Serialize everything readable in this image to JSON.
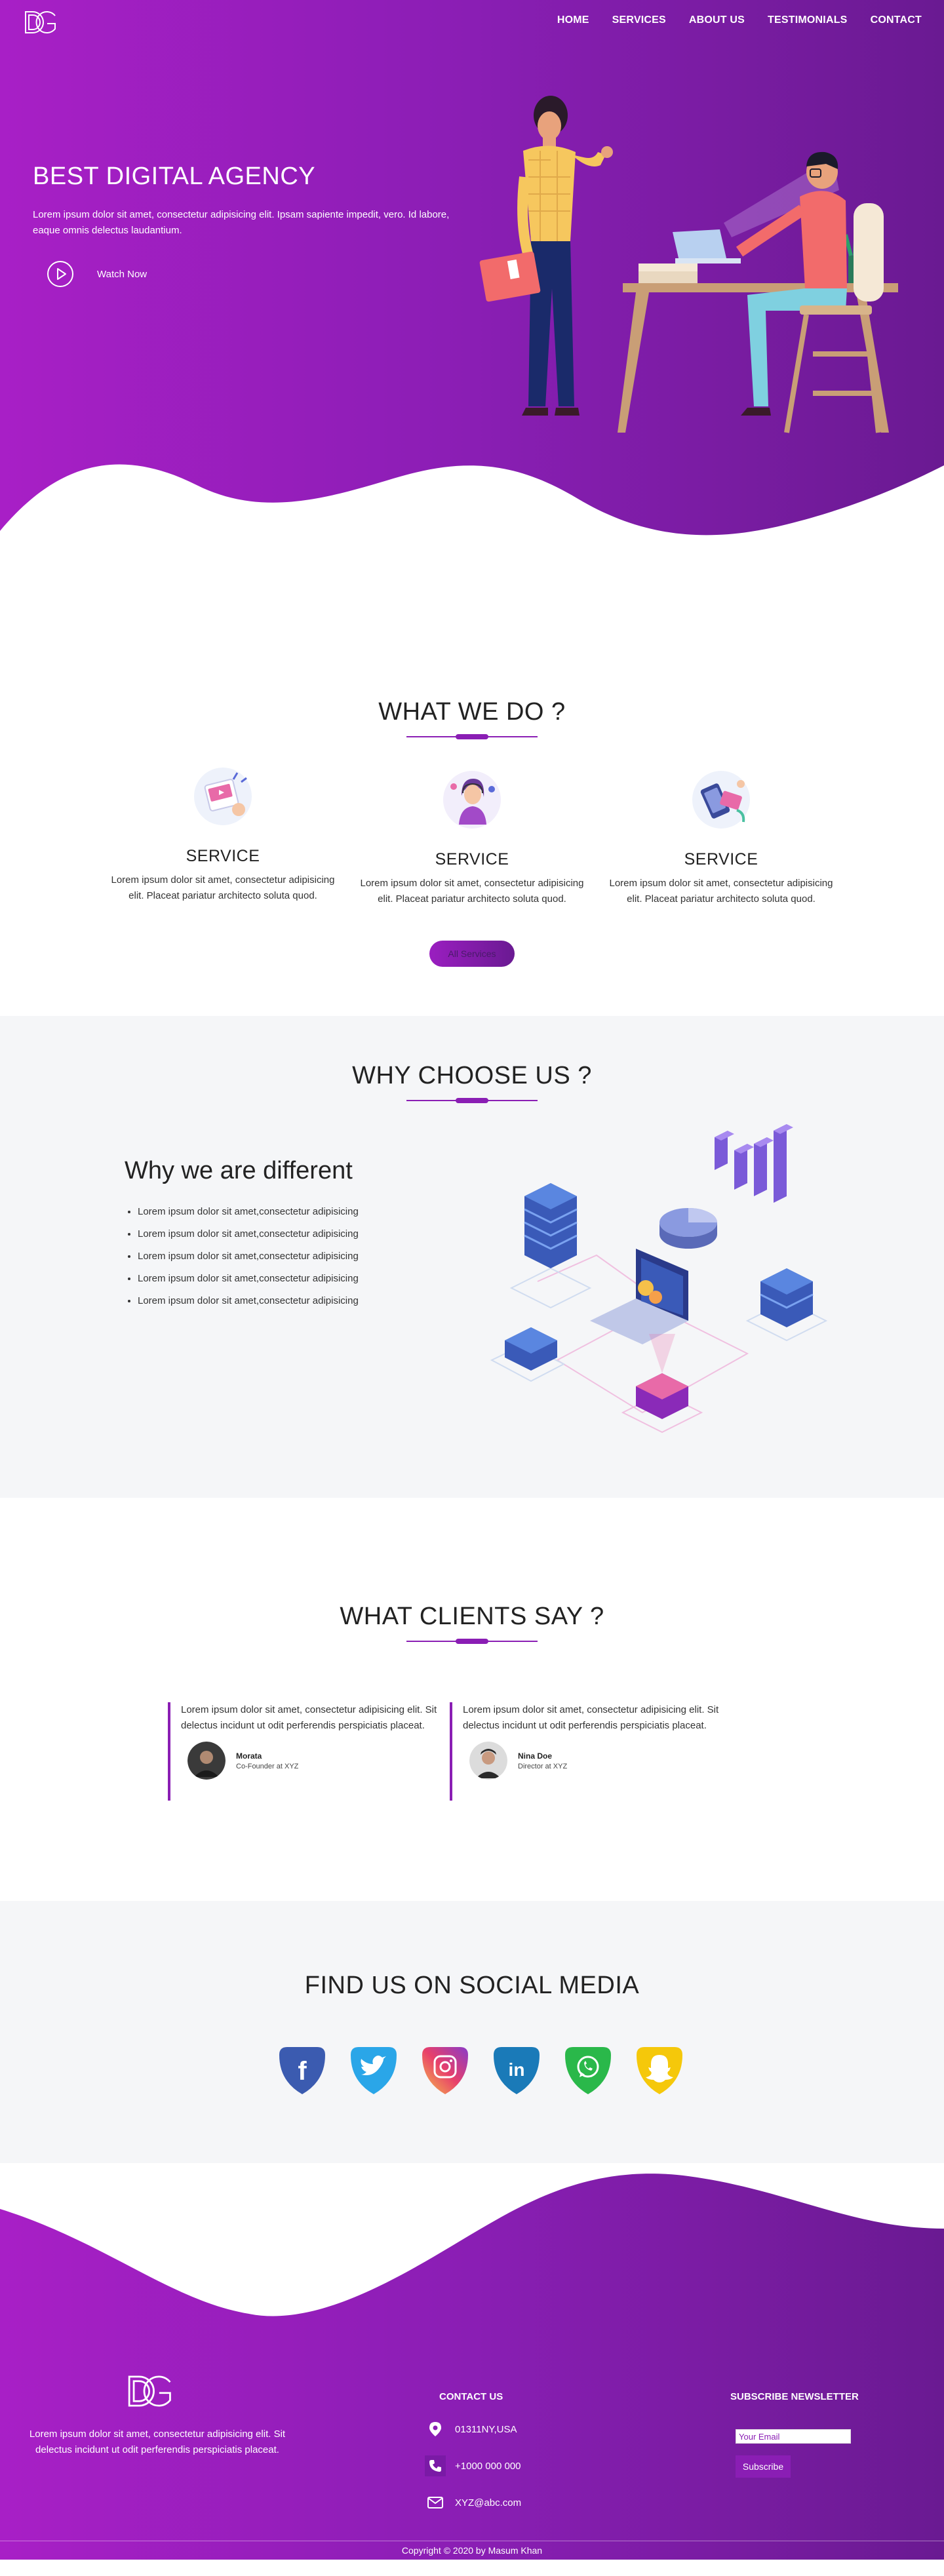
{
  "colors": {
    "primary": "#8a1eb4",
    "primary_light": "#a81fc6",
    "primary_dark": "#6a1a92",
    "section_bg": "#f5f6f8"
  },
  "nav": {
    "logo_icon": "dg-logo",
    "links": [
      "HOME",
      "SERVICES",
      "ABOUT US",
      "TESTIMONIALS",
      "CONTACT"
    ]
  },
  "hero": {
    "title": "BEST DIGITAL AGENCY",
    "text": "Lorem ipsum dolor sit amet, consectetur adipisicing elit. Ipsam sapiente impedit, vero. Id labore, eaque omnis delectus laudantium.",
    "watch_label": "Watch Now"
  },
  "what_we_do": {
    "title": "WHAT WE DO ?",
    "services": [
      {
        "heading": "SERVICE",
        "text": "Lorem ipsum dolor sit amet, consectetur adipisicing elit. Placeat pariatur architecto soluta quod.",
        "icon": "video-app-icon"
      },
      {
        "heading": "SERVICE",
        "text": "Lorem ipsum dolor sit amet, consectetur adipisicing elit. Placeat pariatur architecto soluta quod.",
        "icon": "support-agent-icon"
      },
      {
        "heading": "SERVICE",
        "text": "Lorem ipsum dolor sit amet, consectetur adipisicing elit. Placeat pariatur architecto soluta quod.",
        "icon": "mobile-payment-icon"
      }
    ],
    "button_label": "All Services"
  },
  "why_choose": {
    "title": "WHY CHOOSE US ?",
    "heading": "Why we are different",
    "items": [
      "Lorem ipsum dolor sit amet,consectetur adipisicing",
      "Lorem ipsum dolor sit amet,consectetur adipisicing",
      "Lorem ipsum dolor sit amet,consectetur adipisicing",
      "Lorem ipsum dolor sit amet,consectetur adipisicing",
      "Lorem ipsum dolor sit amet,consectetur adipisicing"
    ]
  },
  "clients": {
    "title": "WHAT CLIENTS SAY ?",
    "testimonials": [
      {
        "text": "Lorem ipsum dolor sit amet, consectetur adipisicing elit. Sit delectus incidunt ut odit perferendis perspiciatis placeat.",
        "name": "Morata",
        "role": "Co-Founder at XYZ"
      },
      {
        "text": "Lorem ipsum dolor sit amet, consectetur adipisicing elit. Sit delectus incidunt ut odit perferendis perspiciatis placeat.",
        "name": "Nina Doe",
        "role": "Director at XYZ"
      }
    ]
  },
  "social": {
    "title": "FIND US ON SOCIAL MEDIA",
    "icons": [
      "facebook-icon",
      "twitter-icon",
      "instagram-icon",
      "linkedin-icon",
      "whatsapp-icon",
      "snapchat-icon"
    ]
  },
  "footer": {
    "about": "Lorem ipsum dolor sit amet, consectetur adipisicing elit. Sit delectus incidunt ut odit perferendis perspiciatis placeat.",
    "contact_title": "CONTACT US",
    "address": "01311NY,USA",
    "phone": "+1000 000 000",
    "email": "XYZ@abc.com",
    "newsletter_title": "SUBSCRIBE NEWSLETTER",
    "email_placeholder": "Your Email",
    "subscribe_label": "Subscribe",
    "copyright": "Copyright © 2020 by Masum Khan"
  }
}
